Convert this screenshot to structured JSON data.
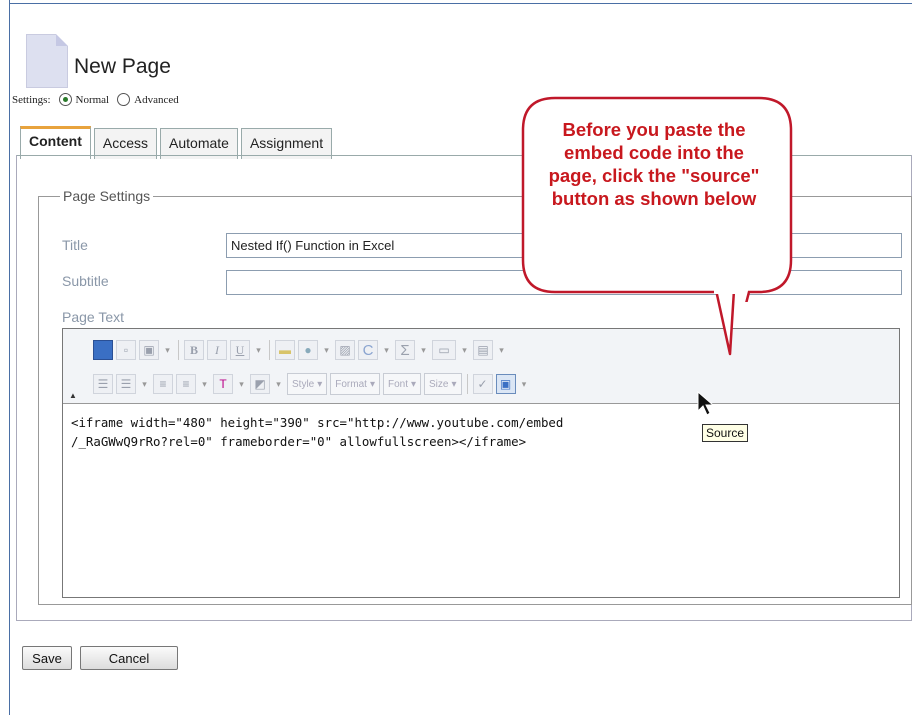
{
  "page": {
    "title": "New Page"
  },
  "settings": {
    "label": "Settings:",
    "options": [
      "Normal",
      "Advanced"
    ],
    "selected": "Normal"
  },
  "tabs": [
    "Content",
    "Access",
    "Automate",
    "Assignment"
  ],
  "active_tab": "Content",
  "fieldset": {
    "legend": "Page Settings"
  },
  "fields": {
    "title_label": "Title",
    "title_value": "Nested If() Function in Excel",
    "subtitle_label": "Subtitle",
    "subtitle_value": "",
    "page_text_label": "Page Text"
  },
  "toolbar": {
    "row1_icons": [
      "insert-media-icon",
      "paste-icon",
      "paste-text-icon",
      "bold-icon",
      "italic-icon",
      "underline-icon",
      "folder-icon",
      "user-icon",
      "image-icon",
      "special-char-icon",
      "sum-icon",
      "window-icon",
      "document-icon"
    ],
    "row1_glyphs": {
      "bold": "B",
      "italic": "I",
      "underline": "U",
      "sum": "Σ",
      "special": "C"
    },
    "row2_icons": [
      "ordered-list-icon",
      "bulleted-list-icon",
      "align-left-icon",
      "align-center-icon",
      "text-color-icon",
      "background-color-icon",
      "spellcheck-icon",
      "source-icon"
    ],
    "combos": [
      "Style",
      "Format",
      "Font",
      "Size"
    ]
  },
  "editor": {
    "line1": "<iframe width=\"480\" height=\"390\" src=\"http://www.youtube.com/embed",
    "line2": "/_RaGWwQ9rRo?rel=0\" frameborder=\"0\" allowfullscreen></iframe>"
  },
  "tooltip": "Source",
  "callout": {
    "text": "Before you paste the embed code into the page, click the \"source\" button as shown below",
    "color": "#c8181e"
  },
  "buttons": {
    "save": "Save",
    "cancel": "Cancel"
  }
}
